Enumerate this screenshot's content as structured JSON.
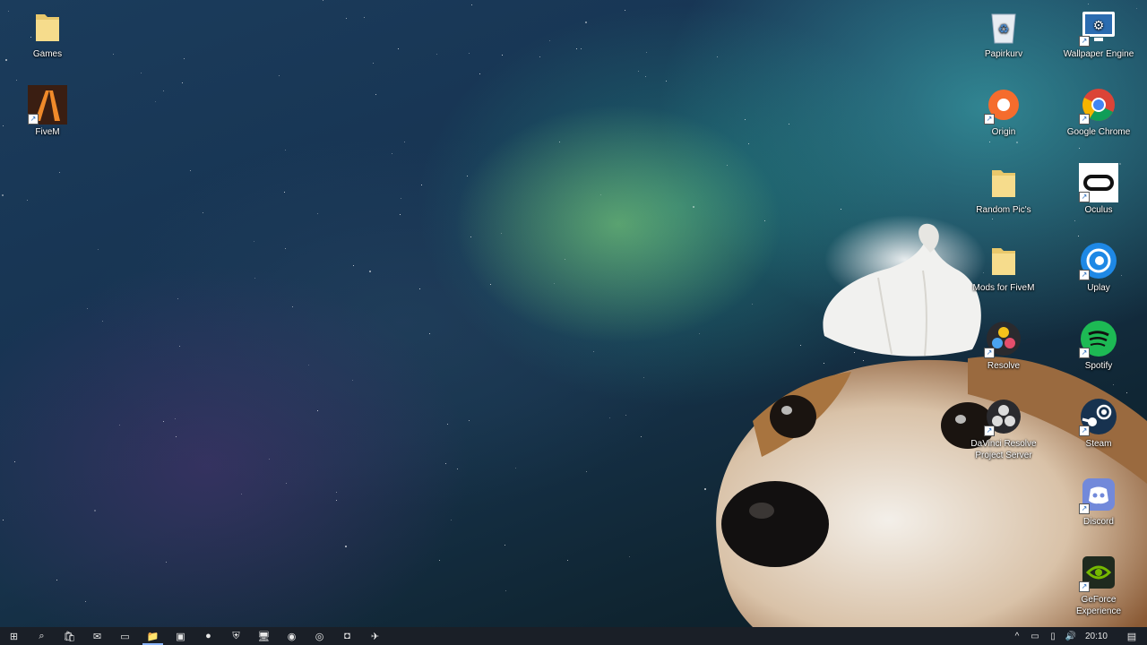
{
  "desktop": {
    "icons_left": [
      {
        "label": "Games",
        "icon": "folder-icon",
        "shortcut": false
      },
      {
        "label": "FiveM",
        "icon": "fivem-icon",
        "shortcut": true
      }
    ],
    "icons_col1": [
      {
        "label": "Papirkurv",
        "icon": "recycle-bin-icon",
        "shortcut": false
      },
      {
        "label": "Origin",
        "icon": "origin-icon",
        "shortcut": true
      },
      {
        "label": "Random Pic's",
        "icon": "folder-icon",
        "shortcut": false
      },
      {
        "label": "Mods for FiveM",
        "icon": "folder-icon",
        "shortcut": false
      },
      {
        "label": "Resolve",
        "icon": "davinci-resolve-icon",
        "shortcut": true
      },
      {
        "label": "DaVinci Resolve Project Server",
        "icon": "davinci-server-icon",
        "shortcut": true
      }
    ],
    "icons_col2": [
      {
        "label": "Wallpaper Engine",
        "icon": "wallpaper-engine-icon",
        "shortcut": true
      },
      {
        "label": "Google Chrome",
        "icon": "chrome-icon",
        "shortcut": true
      },
      {
        "label": "Oculus",
        "icon": "oculus-icon",
        "shortcut": true
      },
      {
        "label": "Uplay",
        "icon": "uplay-icon",
        "shortcut": true
      },
      {
        "label": "Spotify",
        "icon": "spotify-icon",
        "shortcut": true
      },
      {
        "label": "Steam",
        "icon": "steam-icon",
        "shortcut": true
      },
      {
        "label": "Discord",
        "icon": "discord-icon",
        "shortcut": true
      },
      {
        "label": "GeForce Experience",
        "icon": "geforce-experience-icon",
        "shortcut": true
      }
    ]
  },
  "taskbar": {
    "items": [
      {
        "name": "start-button",
        "glyph": "⊞"
      },
      {
        "name": "search-icon",
        "glyph": "⌕"
      },
      {
        "name": "store-icon",
        "glyph": "🛍"
      },
      {
        "name": "mail-icon",
        "glyph": "✉"
      },
      {
        "name": "oculus-taskbar-icon",
        "glyph": "▭"
      },
      {
        "name": "file-explorer-icon",
        "glyph": "📁"
      },
      {
        "name": "nvidia-taskbar-icon",
        "glyph": "▣"
      },
      {
        "name": "origin-taskbar-icon",
        "glyph": "●"
      },
      {
        "name": "shield-taskbar-icon",
        "glyph": "⛨"
      },
      {
        "name": "monitor-taskbar-icon",
        "glyph": "🖥"
      },
      {
        "name": "spotify-taskbar-icon",
        "glyph": "◉"
      },
      {
        "name": "chrome-taskbar-icon",
        "glyph": "◎"
      },
      {
        "name": "discord-taskbar-icon",
        "glyph": "◘"
      },
      {
        "name": "steam-taskbar-icon",
        "glyph": "✈"
      }
    ],
    "tray": {
      "chevron": "^",
      "battery": "▭",
      "network": "▯",
      "volume": "🔊",
      "clock": "20:10",
      "notifications": "▤"
    }
  },
  "colors": {
    "taskbar_bg": "#1a1f27",
    "active_indicator": "#8ab4f8"
  }
}
